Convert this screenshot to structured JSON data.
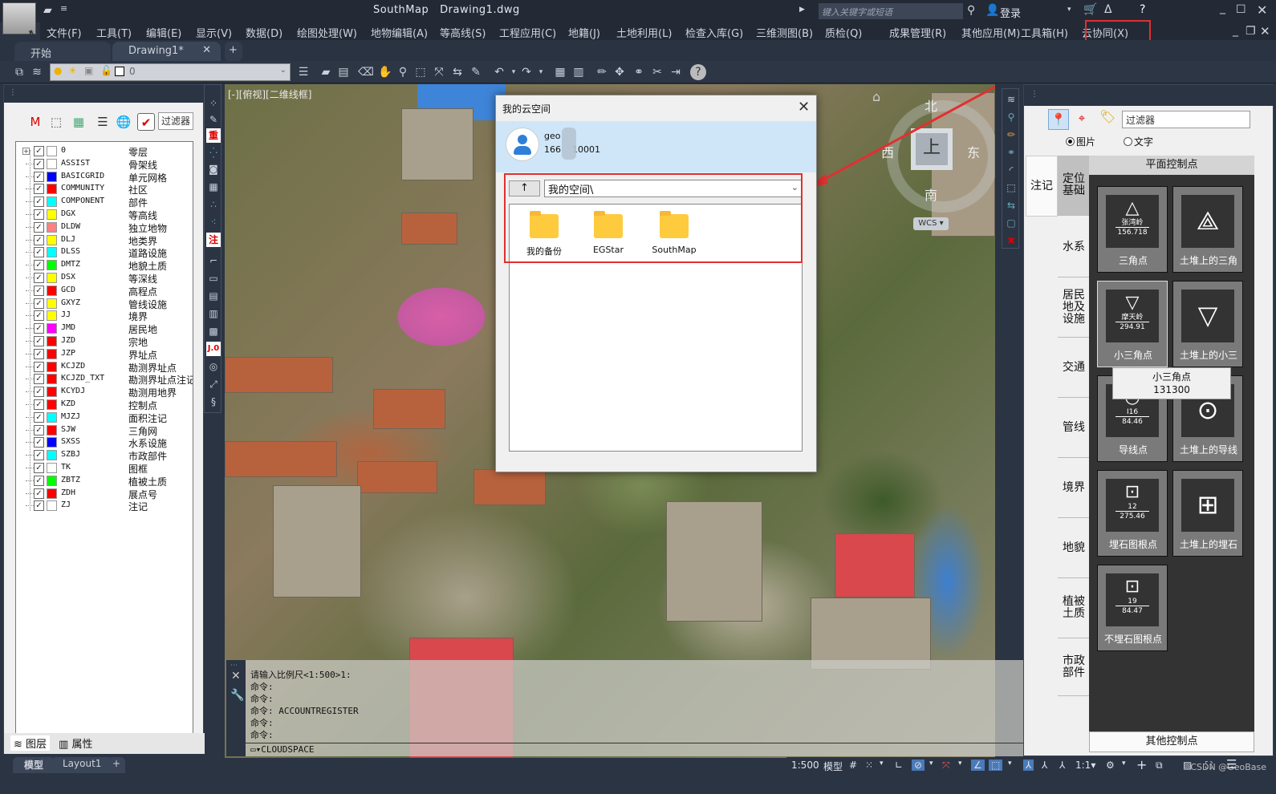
{
  "app": {
    "title": "SouthMap",
    "document": "Drawing1.dwg",
    "logo_letter": "A",
    "search_placeholder": "键入关键字或短语",
    "login_label": "登录"
  },
  "menu": [
    "文件(F)",
    "工具(T)",
    "编辑(E)",
    "显示(V)",
    "数据(D)",
    "绘图处理(W)",
    "地物编辑(A)",
    "等高线(S)",
    "工程应用(C)",
    "地籍(J)",
    "土地利用(L)",
    "检查入库(G)",
    "三维测图(B)",
    "质检(Q)",
    "成果管理(R)",
    "其他应用(M)",
    "工具箱(H)",
    "云协同(X)"
  ],
  "tabs": [
    {
      "label": "开始",
      "active": false
    },
    {
      "label": "Drawing1*",
      "active": true
    }
  ],
  "toolbar": {
    "layer_value": "0"
  },
  "layer_panel": {
    "filter_label": "过滤器",
    "layers": [
      {
        "code": "0",
        "name": "零层",
        "color": "#ffffff",
        "checked": true
      },
      {
        "code": "ASSIST",
        "name": "骨架线",
        "color": "#ffffff",
        "checked": true
      },
      {
        "code": "BASICGRID",
        "name": "单元网格",
        "color": "#0000ff",
        "checked": true
      },
      {
        "code": "COMMUNITY",
        "name": "社区",
        "color": "#ff0000",
        "checked": true
      },
      {
        "code": "COMPONENT",
        "name": "部件",
        "color": "#00ffff",
        "checked": true
      },
      {
        "code": "DGX",
        "name": "等高线",
        "color": "#ffff00",
        "checked": true
      },
      {
        "code": "DLDW",
        "name": "独立地物",
        "color": "#ff8080",
        "checked": true
      },
      {
        "code": "DLJ",
        "name": "地类界",
        "color": "#ffff00",
        "checked": true
      },
      {
        "code": "DLSS",
        "name": "道路设施",
        "color": "#00ffff",
        "checked": true
      },
      {
        "code": "DMTZ",
        "name": "地貌土质",
        "color": "#00ff00",
        "checked": true
      },
      {
        "code": "DSX",
        "name": "等深线",
        "color": "#ffff00",
        "checked": true
      },
      {
        "code": "GCD",
        "name": "高程点",
        "color": "#ff0000",
        "checked": true
      },
      {
        "code": "GXYZ",
        "name": "管线设施",
        "color": "#ffff00",
        "checked": true
      },
      {
        "code": "JJ",
        "name": "境界",
        "color": "#ffff00",
        "checked": true
      },
      {
        "code": "JMD",
        "name": "居民地",
        "color": "#ff00ff",
        "checked": true
      },
      {
        "code": "JZD",
        "name": "宗地",
        "color": "#ff0000",
        "checked": true
      },
      {
        "code": "JZP",
        "name": "界址点",
        "color": "#ff0000",
        "checked": true
      },
      {
        "code": "KCJZD",
        "name": "勘测界址点",
        "color": "#ff0000",
        "checked": true
      },
      {
        "code": "KCJZD_TXT",
        "name": "勘测界址点注记",
        "color": "#ff0000",
        "checked": true
      },
      {
        "code": "KCYDJ",
        "name": "勘测用地界",
        "color": "#ff0000",
        "checked": true
      },
      {
        "code": "KZD",
        "name": "控制点",
        "color": "#ff0000",
        "checked": true
      },
      {
        "code": "MJZJ",
        "name": "面积注记",
        "color": "#00ffff",
        "checked": true
      },
      {
        "code": "SJW",
        "name": "三角网",
        "color": "#ff0000",
        "checked": true
      },
      {
        "code": "SXSS",
        "name": "水系设施",
        "color": "#0000ff",
        "checked": true
      },
      {
        "code": "SZBJ",
        "name": "市政部件",
        "color": "#00ffff",
        "checked": true
      },
      {
        "code": "TK",
        "name": "图框",
        "color": "#ffffff",
        "checked": true
      },
      {
        "code": "ZBTZ",
        "name": "植被土质",
        "color": "#00ff00",
        "checked": true
      },
      {
        "code": "ZDH",
        "name": "展点号",
        "color": "#ff0000",
        "checked": true
      },
      {
        "code": "ZJ",
        "name": "注记",
        "color": "#ffffff",
        "checked": true
      }
    ],
    "bottom_tabs": [
      "图层",
      "属性"
    ]
  },
  "layout_tabs": [
    "模型",
    "Layout1"
  ],
  "viewport": {
    "label": "[-][俯视][二维线框]",
    "compass": {
      "n": "北",
      "s": "南",
      "e": "东",
      "w": "西",
      "cube": "上"
    },
    "ucs": "WCS"
  },
  "command": {
    "history": [
      "请输入比例尺<1:500>1:",
      "命令:",
      "命令:",
      "命令: ACCOUNTREGISTER",
      "命令:",
      "命令:"
    ],
    "input": "CLOUDSPACE"
  },
  "dialog": {
    "title": "我的云空间",
    "user_name": "geo",
    "user_phone_prefix": "166",
    "user_phone_suffix": "10001",
    "path": "我的空间\\",
    "up_label": "↑",
    "folders": [
      "我的备份",
      "EGStar",
      "SouthMap"
    ]
  },
  "symbol_panel": {
    "filter": "过滤器",
    "radio": [
      {
        "label": "图片",
        "checked": true
      },
      {
        "label": "文字",
        "checked": false
      }
    ],
    "outer_tab": "注记",
    "categories": [
      "定位基础",
      "水系",
      "居民地及设施",
      "交通",
      "管线",
      "境界",
      "地貌",
      "植被土质",
      "市政部件"
    ],
    "active_category": "定位基础",
    "group_header": "平面控制点",
    "group_footer": "其他控制点",
    "symbols": [
      {
        "label": "三角点",
        "shape": "△",
        "name": "张湾岭",
        "value": "156.718"
      },
      {
        "label": "土堆上的三角",
        "shape": "⟁",
        "name": "",
        "value": ""
      },
      {
        "label": "小三角点",
        "shape": "▽",
        "name": "摩天岭",
        "value": "294.91"
      },
      {
        "label": "土堆上的小三",
        "shape": "▽",
        "name": "",
        "value": ""
      },
      {
        "label": "导线点",
        "shape": "○",
        "name": "I16",
        "value": "84.46"
      },
      {
        "label": "土堆上的导线",
        "shape": "⊙",
        "name": "",
        "value": ""
      },
      {
        "label": "埋石图根点",
        "shape": "⊡",
        "name": "12",
        "value": "275.46"
      },
      {
        "label": "土堆上的埋石",
        "shape": "⊞",
        "name": "",
        "value": ""
      },
      {
        "label": "不埋石图根点",
        "shape": "⊡",
        "name": "19",
        "value": "84.47"
      }
    ],
    "tooltip": {
      "title": "小三角点",
      "code": "131300"
    }
  },
  "status": {
    "scale": "1:500",
    "model": "模型",
    "annoscale": "1:1",
    "watermark": "CSDN @GeoBase"
  },
  "colors": {
    "highlight_red": "#e03030",
    "ui_dark": "#2b3443",
    "folder": "#fecb3e"
  }
}
